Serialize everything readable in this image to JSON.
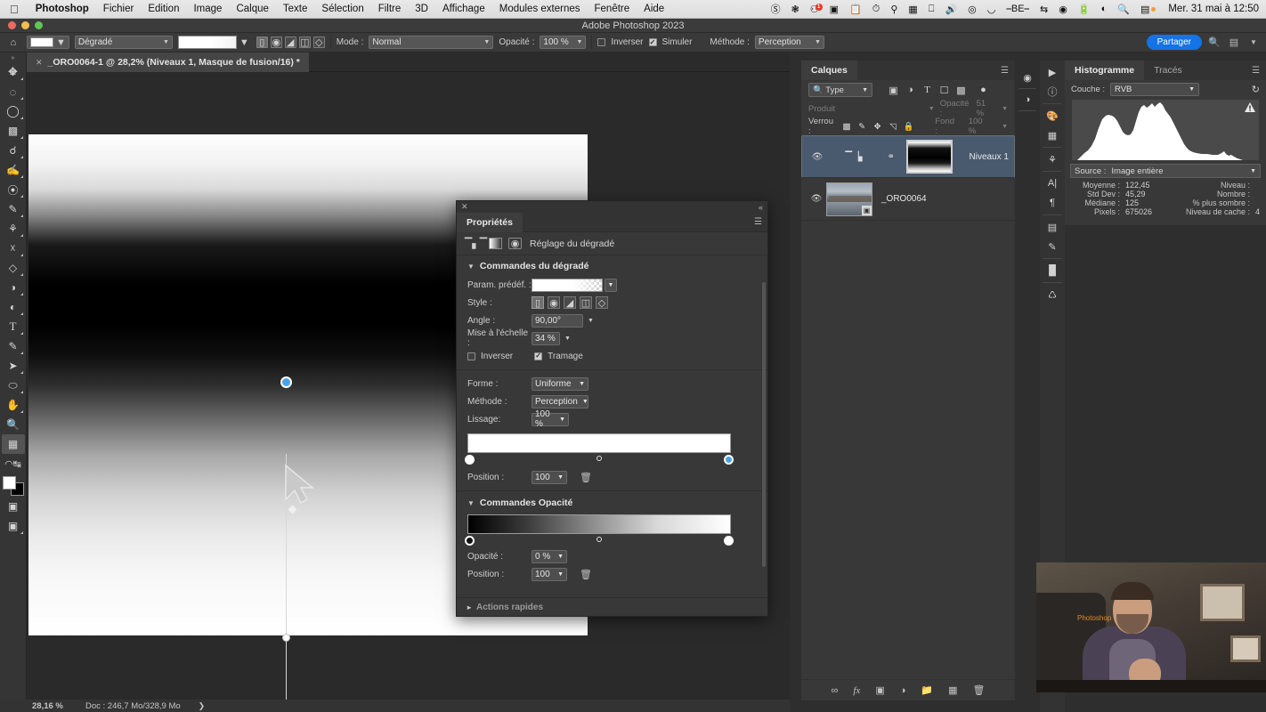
{
  "os_menu": {
    "apple": "apple-logo",
    "items": [
      "Photoshop",
      "Fichier",
      "Edition",
      "Image",
      "Calque",
      "Texte",
      "Sélection",
      "Filtre",
      "3D",
      "Affichage",
      "Modules externes",
      "Fenêtre",
      "Aide"
    ],
    "status_icons": [
      "no-entry-icon",
      "butterfly-icon",
      "notifications-icon",
      "screen-record-icon",
      "clipboard-icon",
      "timer-icon",
      "bandwidth-icon",
      "stats-icon",
      "display-icon",
      "volume-icon",
      "cd-icon",
      "app-icon",
      "be-icon",
      "bluetooth-icon",
      "location-icon",
      "battery-icon",
      "wifi-icon",
      "search-icon",
      "control-center-icon"
    ],
    "notification_badge": "1",
    "clock": "Mer. 31 mai à 12:50"
  },
  "titlebar": {
    "title": "Adobe Photoshop 2023"
  },
  "options_bar": {
    "home_icon": "home-icon",
    "tool_preset_icon": "gradient-tool-preset-icon",
    "tool_name": "Dégradé",
    "gradient_preview": "gradient-swatch",
    "style_buttons": [
      "linear-gradient-icon",
      "radial-gradient-icon",
      "angle-gradient-icon",
      "reflected-gradient-icon",
      "diamond-gradient-icon"
    ],
    "mode_label": "Mode :",
    "mode_value": "Normal",
    "opacity_label": "Opacité :",
    "opacity_value": "100 %",
    "inverser_label": "Inverser",
    "inverser_checked": false,
    "simuler_label": "Simuler",
    "simuler_checked": true,
    "methode_label": "Méthode :",
    "methode_value": "Perception",
    "share_label": "Partager",
    "right_icons": [
      "search-icon",
      "workspace-icon",
      "chevron-down-icon"
    ]
  },
  "document_tab": {
    "close_icon": "close-icon",
    "title": "_ORO0064-1 @ 28,2% (Niveaux 1, Masque de fusion/16) *"
  },
  "toolbar": {
    "expand_icon": "double-chevron-icon",
    "tools": [
      {
        "name": "move-tool",
        "glyph": "✥",
        "active": false
      },
      {
        "name": "marquee-tool",
        "glyph": "◌",
        "active": false
      },
      {
        "name": "lasso-tool",
        "glyph": "◯",
        "active": false
      },
      {
        "name": "object-selection-tool",
        "glyph": "▣",
        "active": false
      },
      {
        "name": "crop-tool",
        "glyph": "⌗",
        "active": false
      },
      {
        "name": "eyedropper-tool",
        "glyph": "✒",
        "active": false
      },
      {
        "name": "healing-brush-tool",
        "glyph": "❏",
        "active": false
      },
      {
        "name": "brush-tool",
        "glyph": "🖌",
        "active": false
      },
      {
        "name": "clone-stamp-tool",
        "glyph": "⎈",
        "active": false
      },
      {
        "name": "history-brush-tool",
        "glyph": "⌧",
        "active": false
      },
      {
        "name": "eraser-tool",
        "glyph": "◿",
        "active": false
      },
      {
        "name": "gradient-tool",
        "glyph": "◑",
        "active": false
      },
      {
        "name": "dodge-tool",
        "glyph": "◐",
        "active": false
      },
      {
        "name": "type-tool",
        "glyph": "T",
        "active": false
      },
      {
        "name": "pen-tool",
        "glyph": "✎",
        "active": false
      },
      {
        "name": "path-selection-tool",
        "glyph": "➤",
        "active": false
      },
      {
        "name": "shape-tool",
        "glyph": "⬭",
        "active": false
      },
      {
        "name": "hand-tool",
        "glyph": "✋",
        "active": false
      },
      {
        "name": "zoom-tool",
        "glyph": "🔍",
        "active": false
      },
      {
        "name": "gradient-active-tool",
        "glyph": "▤",
        "active": true
      },
      {
        "name": "edit-toolbar",
        "glyph": "⋯",
        "active": false
      }
    ],
    "foreground_color": "#ffffff",
    "background_color": "#000000",
    "quickmask_icon": "quick-mask-icon",
    "screenmode_icon": "screen-mode-icon"
  },
  "canvas": {
    "gradient_line": "gradient-drag-line",
    "start_handle": "gradient-start-handle",
    "mid_handle": "gradient-midpoint-handle",
    "end_handle": "gradient-end-handle",
    "cursor": "arrow-cursor"
  },
  "status_bar": {
    "zoom": "28,16 %",
    "doc": "Doc : 246,7 Mo/328,9 Mo",
    "arrow": "❯"
  },
  "properties": {
    "close_icon": "close-icon",
    "collapse_icon": "collapse-panel-icon",
    "tab": "Propriétés",
    "menu_icon": "panel-menu-icon",
    "adjust_icons": [
      "levels-icon",
      "gradient-map-icon",
      "mask-icon"
    ],
    "adjust_title": "Réglage du dégradé",
    "section1": "Commandes du dégradé",
    "preset_label": "Param. prédéf. :",
    "style_label": "Style :",
    "style_buttons": [
      "linear-icon",
      "radial-icon",
      "angle-icon",
      "reflected-icon",
      "diamond-icon"
    ],
    "angle_label": "Angle :",
    "angle_value": "90,00°",
    "scale_label": "Mise à l'échelle :",
    "scale_value": "34 %",
    "inverser_label": "Inverser",
    "inverser_checked": false,
    "tramage_label": "Tramage",
    "tramage_checked": true,
    "forme_label": "Forme :",
    "forme_value": "Uniforme",
    "methode_label": "Méthode :",
    "methode_value": "Perception",
    "lissage_label": "Lissage:",
    "lissage_value": "100 %",
    "color_position_label": "Position :",
    "color_position_value": "100",
    "delete_icon": "trash-icon",
    "section2": "Commandes Opacité",
    "opacity_label": "Opacité :",
    "opacity_value": "0 %",
    "opacity_position_label": "Position :",
    "opacity_position_value": "100",
    "footer": "Actions rapides"
  },
  "layers": {
    "tab": "Calques",
    "menu_icon": "panel-menu-icon",
    "filter_label": "Type",
    "filter_icons": [
      "pixel-filter-icon",
      "adjustment-filter-icon",
      "type-filter-icon",
      "shape-filter-icon",
      "smartobject-filter-icon"
    ],
    "filter_toggle": "filter-toggle-icon",
    "blend_mode": "Produit",
    "opacity_label": "Opacité :",
    "opacity_value": "51 %",
    "lock_label": "Verrou :",
    "lock_icons": [
      "lock-transparency-icon",
      "lock-image-icon",
      "lock-position-icon",
      "lock-artboard-icon",
      "lock-all-icon"
    ],
    "fill_label": "Fond :",
    "fill_value": "100 %",
    "items": [
      {
        "name": "Niveaux 1",
        "visible": true,
        "selected": true,
        "type": "adjustment-levels",
        "link_icon": "link-icon"
      },
      {
        "name": "_ORO0064",
        "visible": true,
        "selected": false,
        "type": "image",
        "badge": "smart-object-badge"
      }
    ],
    "footer_icons": [
      "link-layers-icon",
      "fx-icon",
      "add-mask-icon",
      "new-adjustment-icon",
      "new-group-icon",
      "new-layer-icon",
      "delete-layer-icon"
    ]
  },
  "histogram": {
    "tab": "Histogramme",
    "tab2": "Tracés",
    "menu_icon": "panel-menu-icon",
    "channel_label": "Couche :",
    "channel_value": "RVB",
    "refresh_icon": "refresh-icon",
    "warning_icon": "cached-data-warning-icon",
    "source_label": "Source :",
    "source_value": "Image entière",
    "stats": [
      {
        "key": "Moyenne :",
        "value": "122,45",
        "key2": "Niveau :",
        "value2": ""
      },
      {
        "key": "Std Dev :",
        "value": "45,29",
        "key2": "Nombre :",
        "value2": ""
      },
      {
        "key": "Médiane :",
        "value": "125",
        "key2": "% plus sombre :",
        "value2": ""
      },
      {
        "key": "Pixels :",
        "value": "675026",
        "key2": "Niveau de cache :",
        "value2": "4"
      }
    ]
  },
  "icon_rail": {
    "mini": [
      "color-wheel-icon",
      "adjustments-icon"
    ],
    "main": [
      "play-icon",
      "info-icon",
      "color-palette-icon",
      "swatches-icon",
      "stamp-icon",
      "character-icon",
      "paragraph-icon",
      "layer-comps-icon",
      "notes-icon",
      "actions-icon",
      "history-icon"
    ]
  },
  "webcam": {
    "label": "webcam-overlay",
    "watermark": "Photoshop"
  },
  "colors": {
    "accent": "#1473e6",
    "panel_bg": "#383838",
    "selected_layer": "#4a5a6e",
    "handle_blue": "#4aa3e8"
  }
}
